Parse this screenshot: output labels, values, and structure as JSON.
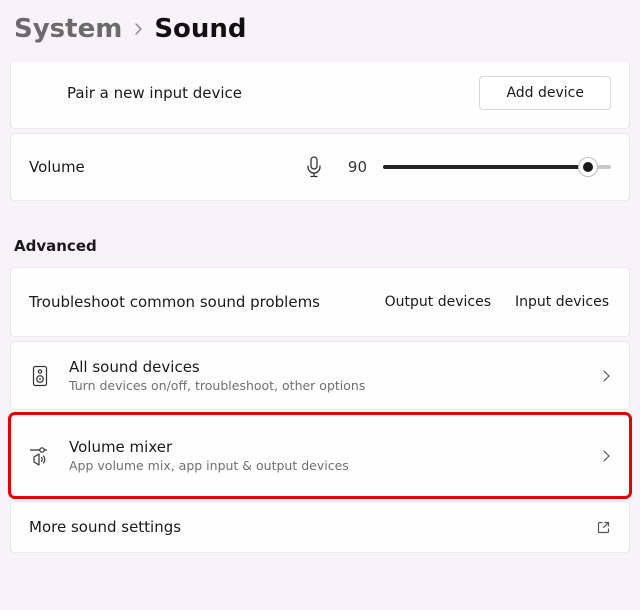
{
  "breadcrumb": {
    "parent": "System",
    "current": "Sound"
  },
  "pair": {
    "label": "Pair a new input device",
    "button": "Add device"
  },
  "volume": {
    "label": "Volume",
    "value": "90",
    "percent": 90
  },
  "section_advanced": "Advanced",
  "troubleshoot": {
    "title": "Troubleshoot common sound problems",
    "output": "Output devices",
    "input": "Input devices"
  },
  "all_sound": {
    "title": "All sound devices",
    "sub": "Turn devices on/off, troubleshoot, other options"
  },
  "mixer": {
    "title": "Volume mixer",
    "sub": "App volume mix, app input & output devices"
  },
  "more": {
    "title": "More sound settings"
  }
}
